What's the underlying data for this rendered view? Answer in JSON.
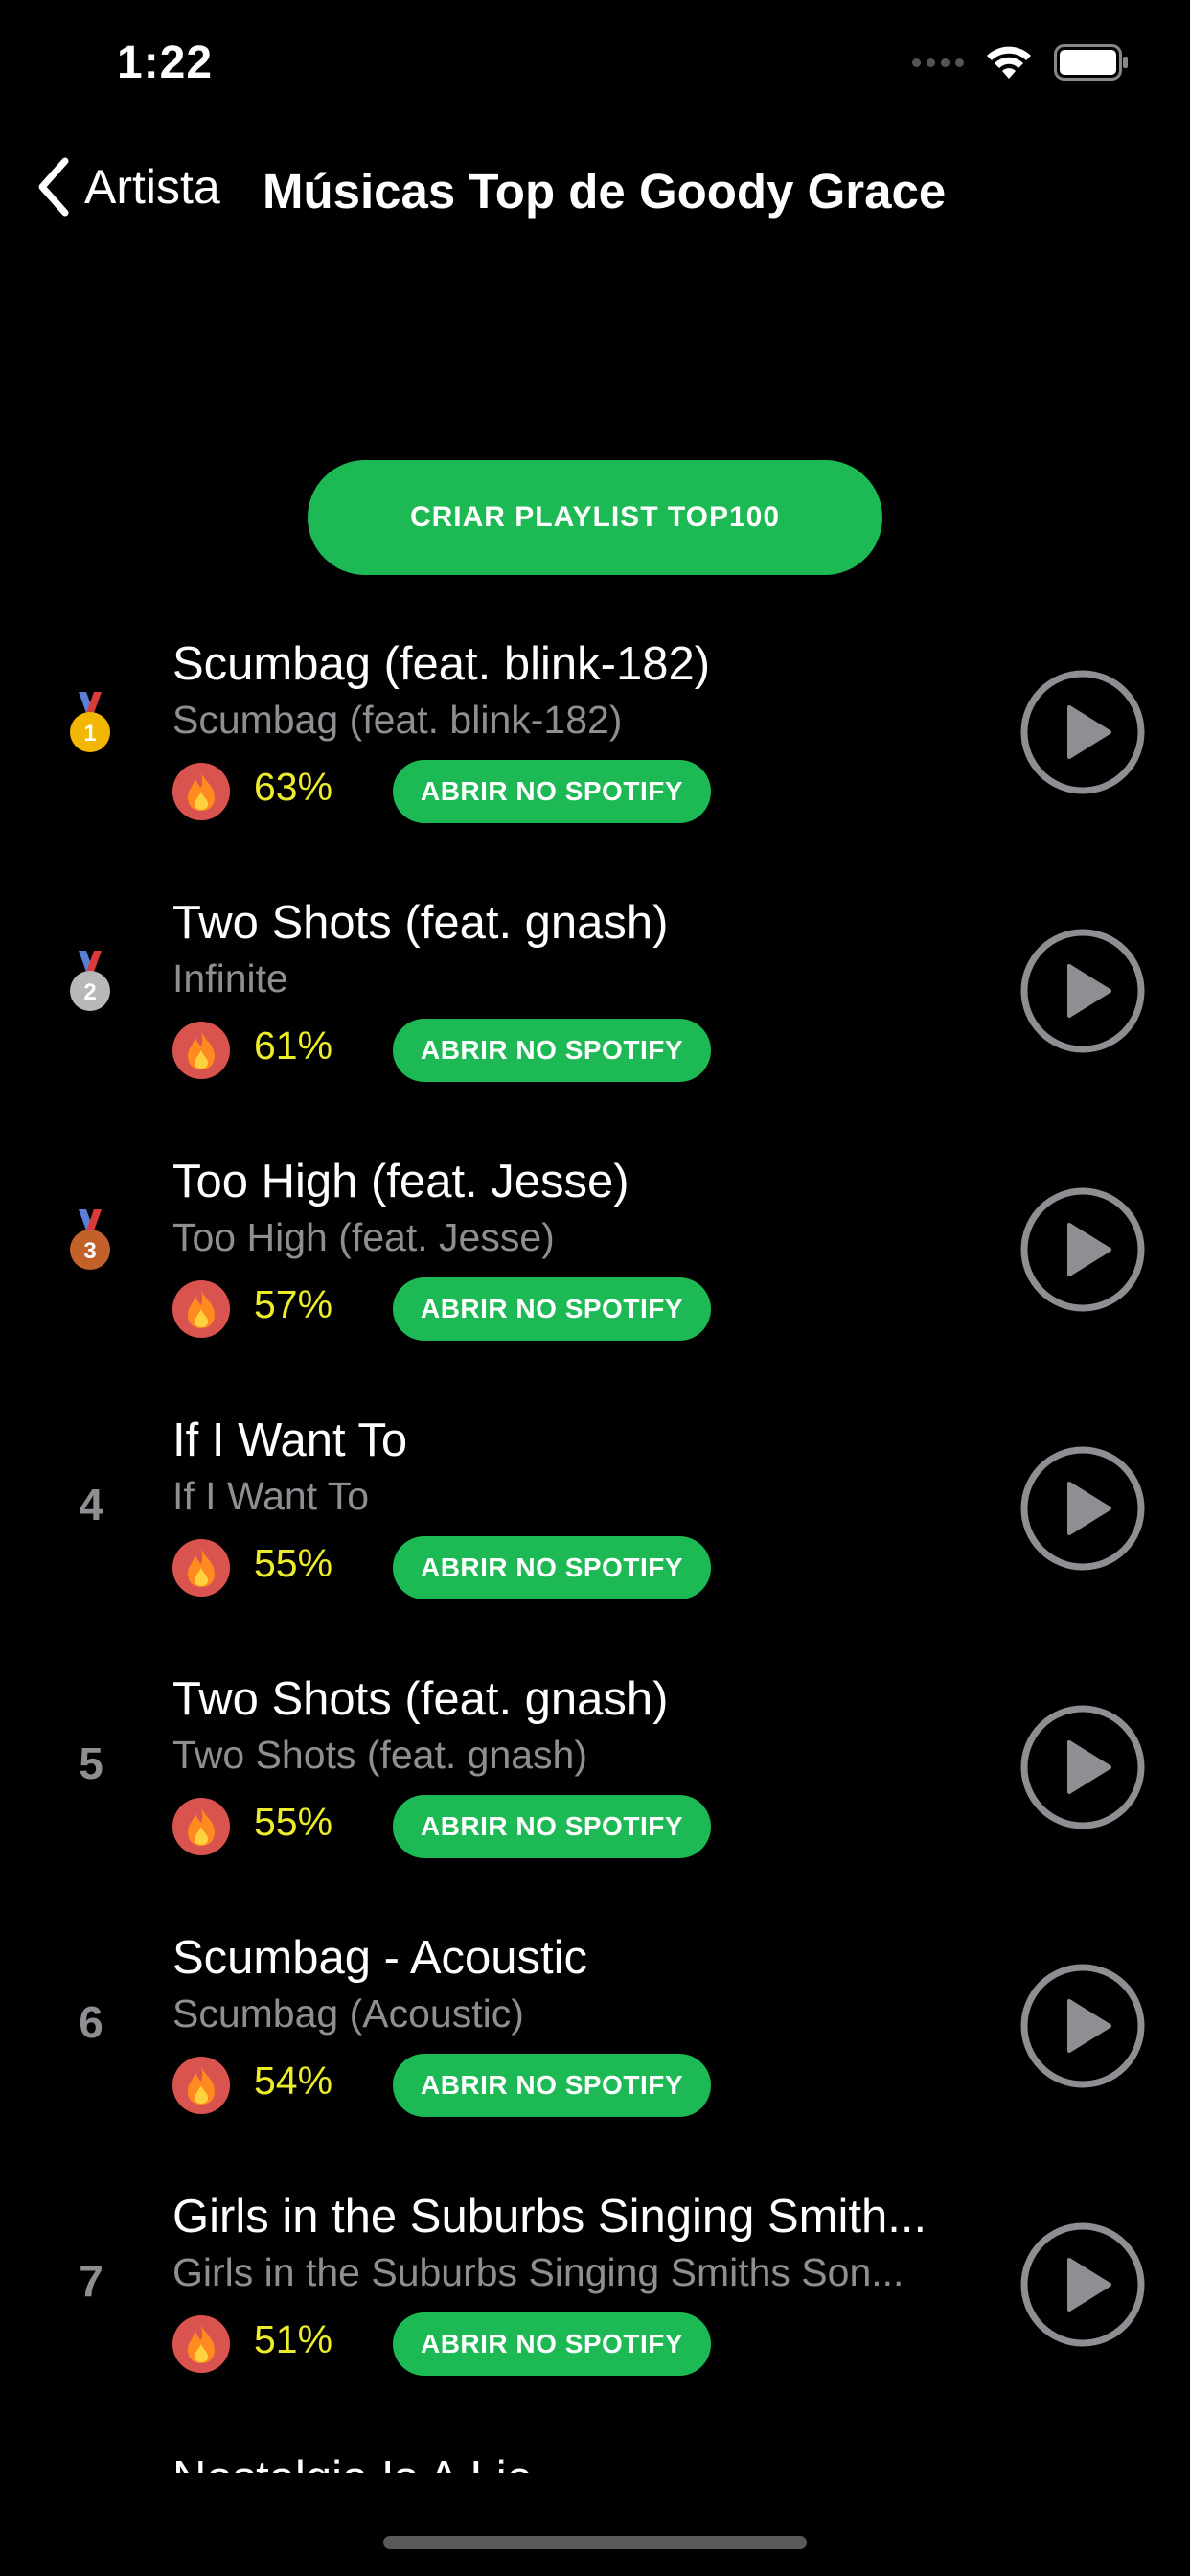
{
  "status_bar": {
    "time": "1:22"
  },
  "nav": {
    "back_label": "Artista",
    "title": "Músicas Top de Goody Grace"
  },
  "cta": {
    "label": "CRIAR PLAYLIST TOP100"
  },
  "tracks": [
    {
      "rank": "1",
      "medal": "gold",
      "title": "Scumbag (feat. blink-182)",
      "subtitle": "Scumbag (feat. blink-182)",
      "popularity": "63%",
      "spotify_label": "ABRIR NO SPOTIFY"
    },
    {
      "rank": "2",
      "medal": "silver",
      "title": "Two Shots (feat. gnash)",
      "subtitle": "Infinite",
      "popularity": "61%",
      "spotify_label": "ABRIR NO SPOTIFY"
    },
    {
      "rank": "3",
      "medal": "bronze",
      "title": "Too High (feat. Jesse)",
      "subtitle": "Too High (feat. Jesse)",
      "popularity": "57%",
      "spotify_label": "ABRIR NO SPOTIFY"
    },
    {
      "rank": "4",
      "medal": null,
      "title": "If I Want To",
      "subtitle": "If I Want To",
      "popularity": "55%",
      "spotify_label": "ABRIR NO SPOTIFY"
    },
    {
      "rank": "5",
      "medal": null,
      "title": "Two Shots (feat. gnash)",
      "subtitle": "Two Shots (feat. gnash)",
      "popularity": "55%",
      "spotify_label": "ABRIR NO SPOTIFY"
    },
    {
      "rank": "6",
      "medal": null,
      "title": "Scumbag - Acoustic",
      "subtitle": "Scumbag (Acoustic)",
      "popularity": "54%",
      "spotify_label": "ABRIR NO SPOTIFY"
    },
    {
      "rank": "7",
      "medal": null,
      "title": "Girls in the Suburbs Singing Smith...",
      "subtitle": "Girls in the Suburbs Singing Smiths Son...",
      "popularity": "51%",
      "spotify_label": "ABRIR NO SPOTIFY"
    }
  ],
  "peek_track": {
    "title": "Nostalgia Is A Lie"
  },
  "colors": {
    "background": "#000000",
    "accent_green": "#1db954",
    "popularity_yellow": "#ecec2a",
    "subtitle_gray": "#8e8e93",
    "fire_red": "#d9534f"
  },
  "icons": {
    "back": "chevron-left-icon",
    "fire": "fire-icon",
    "play": "play-circle-icon",
    "wifi": "wifi-icon",
    "battery": "battery-icon"
  }
}
